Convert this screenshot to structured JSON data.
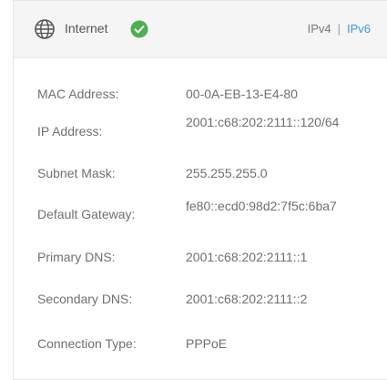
{
  "header": {
    "title": "Internet",
    "status_icon": "check-circle-icon",
    "globe_icon": "globe-icon",
    "protocols": {
      "ipv4": "IPv4",
      "separator": "|",
      "ipv6": "IPv6"
    },
    "colors": {
      "status_green": "#4caf50",
      "active_tab": "#3a9ad9"
    }
  },
  "fields": [
    {
      "label": "MAC Address:",
      "value": "00-0A-EB-13-E4-80"
    },
    {
      "label": "IP Address:",
      "value": "2001:c68:202:2111::120/64"
    },
    {
      "label": "Subnet Mask:",
      "value": "255.255.255.0"
    },
    {
      "label": "Default Gateway:",
      "value": "fe80::ecd0:98d2:7f5c:6ba7"
    },
    {
      "label": "Primary DNS:",
      "value": "2001:c68:202:2111::1"
    },
    {
      "label": "Secondary DNS:",
      "value": "2001:c68:202:2111::2"
    },
    {
      "label": "Connection Type:",
      "value": "PPPoE"
    }
  ]
}
